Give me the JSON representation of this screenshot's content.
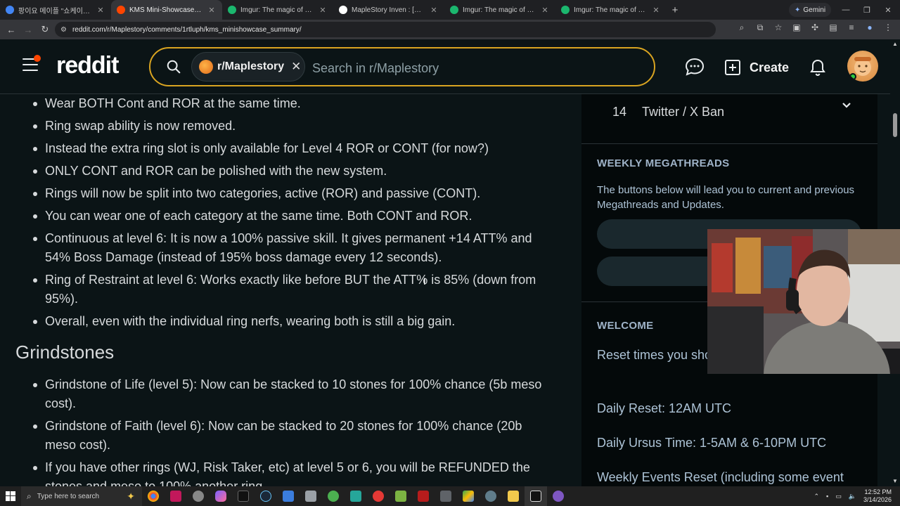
{
  "browser": {
    "tabs": [
      {
        "title": "팡이요 메이플 \"쇼케이스\"랜선",
        "favicon_color": "#4285f4",
        "active": false
      },
      {
        "title": "KMS Mini-Showcase Summary",
        "favicon_color": "#ff4500",
        "active": true
      },
      {
        "title": "Imgur: The magic of the Interne",
        "favicon_color": "#1bb76e",
        "active": false
      },
      {
        "title": "MapleStory Inven : [Long Post]",
        "favicon_color": "#ffffff",
        "active": false
      },
      {
        "title": "Imgur: The magic of the Interne",
        "favicon_color": "#1bb76e",
        "active": false
      },
      {
        "title": "Imgur: The magic of the Interne",
        "favicon_color": "#1bb76e",
        "active": false
      }
    ],
    "new_tab": "+",
    "gemini_label": "Gemini",
    "url": "reddit.com/r/Maplestory/comments/1rtluph/kms_minishowcase_summary/"
  },
  "reddit_header": {
    "logo": "reddit",
    "subreddit_chip": "r/Maplestory",
    "search_placeholder": "Search in r/Maplestory",
    "create_label": "Create"
  },
  "post": {
    "ring_bullets": [
      "Wear BOTH Cont and ROR at the same time.",
      "Ring swap ability is now removed.",
      "Instead the extra ring slot is only available for Level 4 ROR or CONT (for now?)",
      "ONLY CONT and ROR can be polished with the new system.",
      "Rings will now be split into two categories, active (ROR) and passive (CONT).",
      "You can wear one of each category at the same time. Both CONT and ROR.",
      "Continuous at level 6: It is now a 100% passive skill. It gives permanent +14 ATT% and 54% Boss Damage (instead of 195% boss damage every 12 seconds).",
      "Ring of Restraint at level 6: Works exactly like before BUT the ATT% is 85% (down from 95%).",
      "Overall, even with the individual ring nerfs, wearing both is still a big gain."
    ],
    "section_heading": "Grindstones",
    "grindstone_bullets": [
      "Grindstone of Life (level 5): Now can be stacked to 10 stones for 100% chance (5b meso cost).",
      "Grindstone of Faith (level 6): Now can be stacked to 20 stones for 100% chance (20b meso cost).",
      "If you have other rings (WJ, Risk Taker, etc) at level 5 or 6, you will be REFUNDED the stones and meso to 100% another ring."
    ]
  },
  "sidebar": {
    "rule_number": "14",
    "rule_title": "Twitter / X Ban",
    "megathreads_heading": "WEEKLY MEGATHREADS",
    "megathreads_text": "The buttons below will lead you to current and previous Megathreads and Updates.",
    "button_1": "General",
    "button_2": "Class",
    "welcome_heading": "WELCOME",
    "reset_intro": "Reset times you should know in UTC Time:",
    "daily_reset": "Daily Reset: 12AM UTC",
    "ursus_time": "Daily Ursus Time: 1-5AM & 6-10PM UTC",
    "weekly_events": "Weekly Events Reset (including some event"
  },
  "taskbar": {
    "search_placeholder": "Type here to search",
    "time": "12:52 PM",
    "date": "3/14/2026"
  }
}
